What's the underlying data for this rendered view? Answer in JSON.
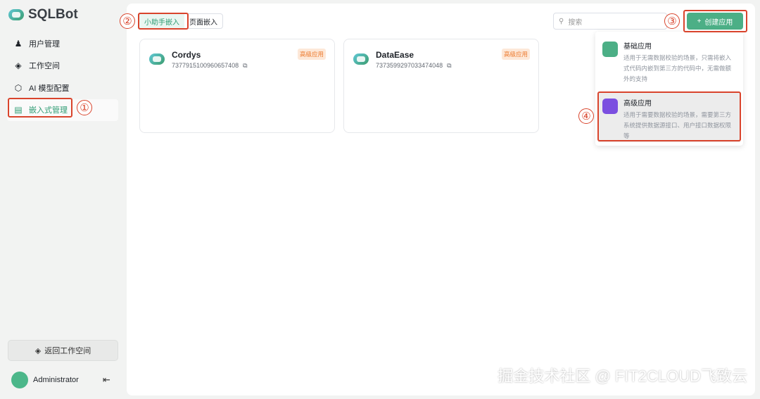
{
  "app": {
    "title": "SQLBot"
  },
  "sidebar": {
    "items": [
      {
        "label": "用户管理",
        "icon": "user-icon"
      },
      {
        "label": "工作空间",
        "icon": "layers-icon"
      },
      {
        "label": "AI 模型配置",
        "icon": "cube-icon"
      },
      {
        "label": "嵌入式管理",
        "icon": "window-icon"
      }
    ],
    "return_label": "返回工作空间",
    "user": "Administrator"
  },
  "tabs": [
    {
      "label": "小助手嵌入"
    },
    {
      "label": "页面嵌入"
    }
  ],
  "search": {
    "placeholder": "搜索"
  },
  "create_label": "创建应用",
  "cards": [
    {
      "name": "Cordys",
      "id": "7377915100960657408",
      "badge": "高级应用"
    },
    {
      "name": "DataEase",
      "id": "7373599297033474048",
      "badge": "高级应用"
    }
  ],
  "menu": [
    {
      "title": "基础应用",
      "desc": "适用于无需数据校验的场景，只需将嵌入式代码内嵌到第三方的代码中，无需做额外的支持",
      "color": "#4caf86"
    },
    {
      "title": "高级应用",
      "desc": "适用于需要数据校验的场景，需要第三方系统提供数据源接口、用户接口数据权限等",
      "color": "#7b4fe0"
    }
  ],
  "annotations": [
    "①",
    "②",
    "③",
    "④"
  ],
  "watermark": "掘金技术社区 @ FIT2CLOUD飞致云"
}
